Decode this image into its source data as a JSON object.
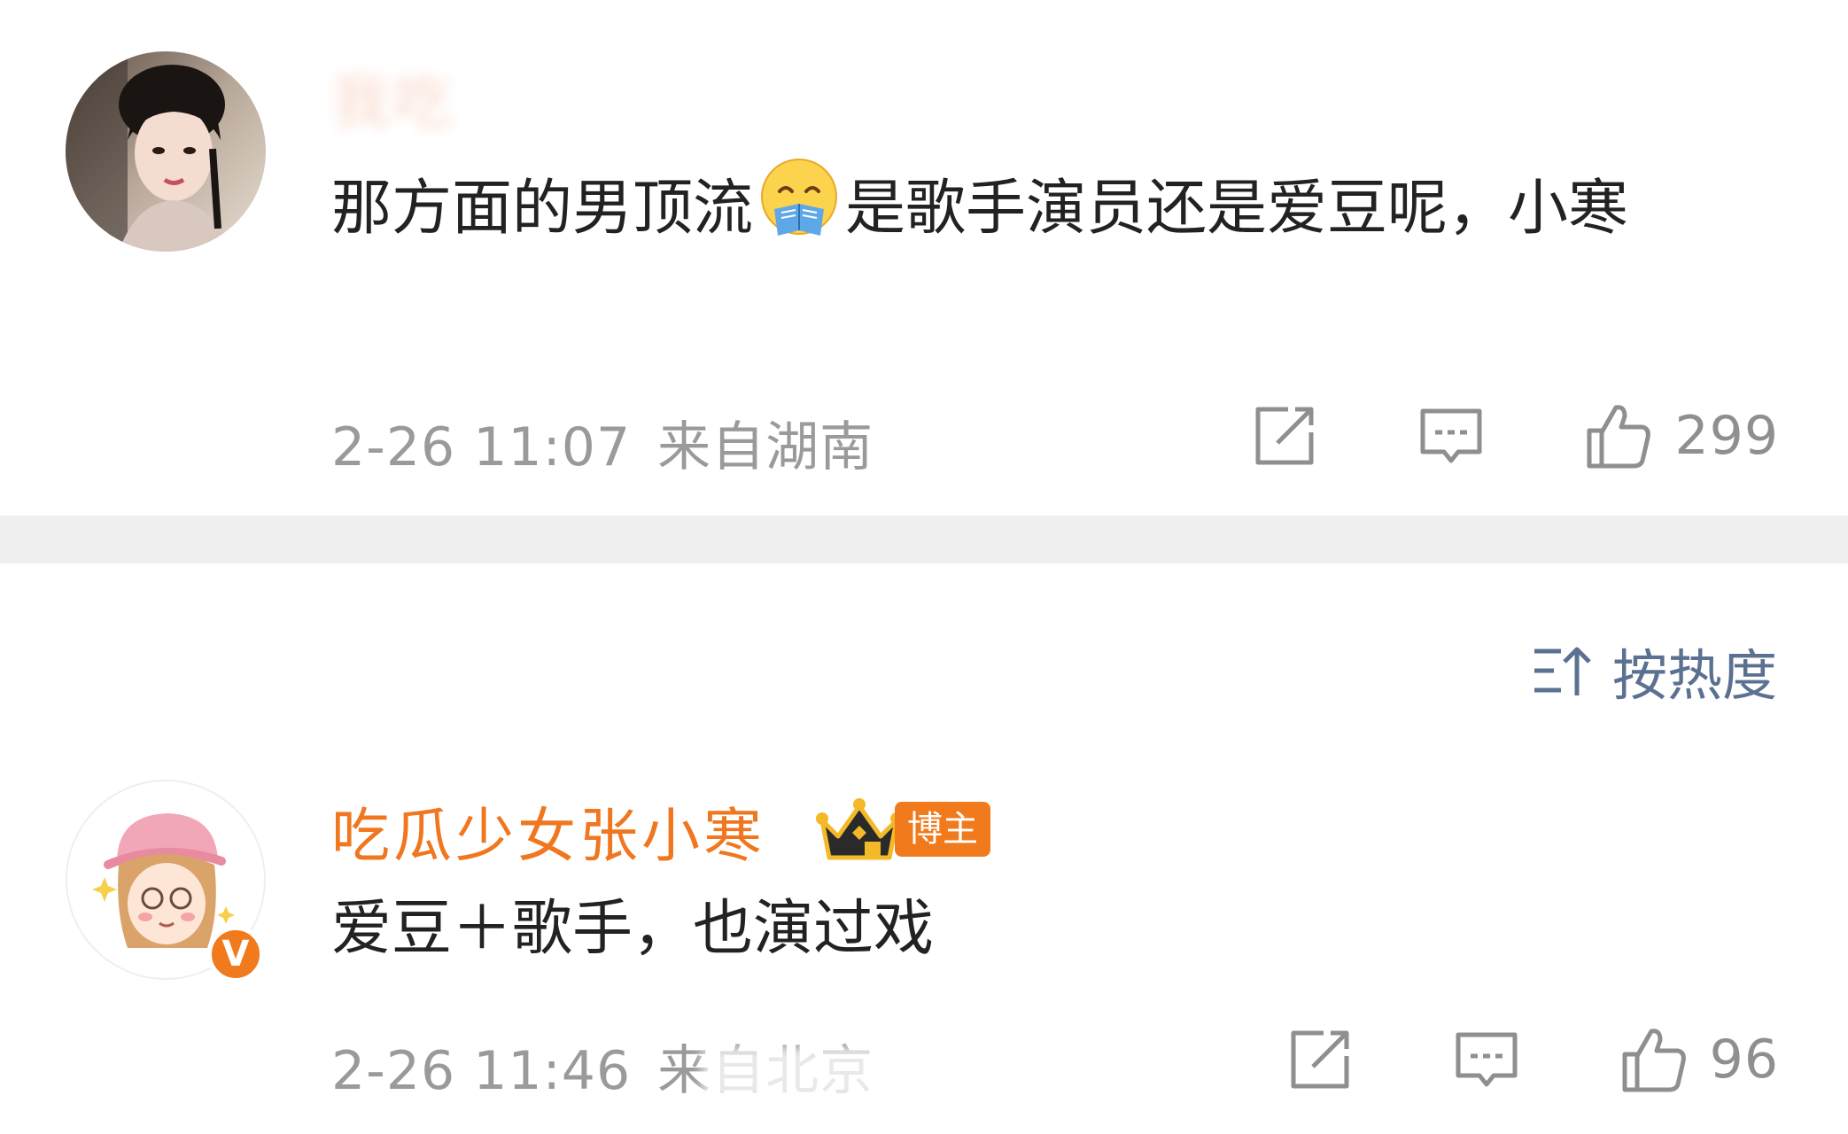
{
  "comments": [
    {
      "username": "我吃",
      "text_before": "那方面的男顶流",
      "emoji": "reading-face-emoji",
      "text_after": "是歌手演员还是爱豆呢，小寒",
      "date": "2-26 11:07",
      "location": "来自湖南",
      "likes": "299"
    },
    {
      "username": "吃瓜少女张小寒",
      "badge_label": "博主",
      "verified_mark": "V",
      "text": "爱豆＋歌手，也演过戏",
      "date": "2-26 11:46",
      "location": "来自北京",
      "likes": "96"
    }
  ],
  "sort": {
    "label": "按热度",
    "icon": "sort-icon"
  },
  "icons": {
    "share": "share-icon",
    "comment": "comment-icon",
    "like": "thumbs-up-icon"
  },
  "colors": {
    "accent_orange": "#f07a1c",
    "sort_blue": "#5b7192",
    "meta_gray": "#9a9a9a",
    "divider": "#efefef"
  }
}
